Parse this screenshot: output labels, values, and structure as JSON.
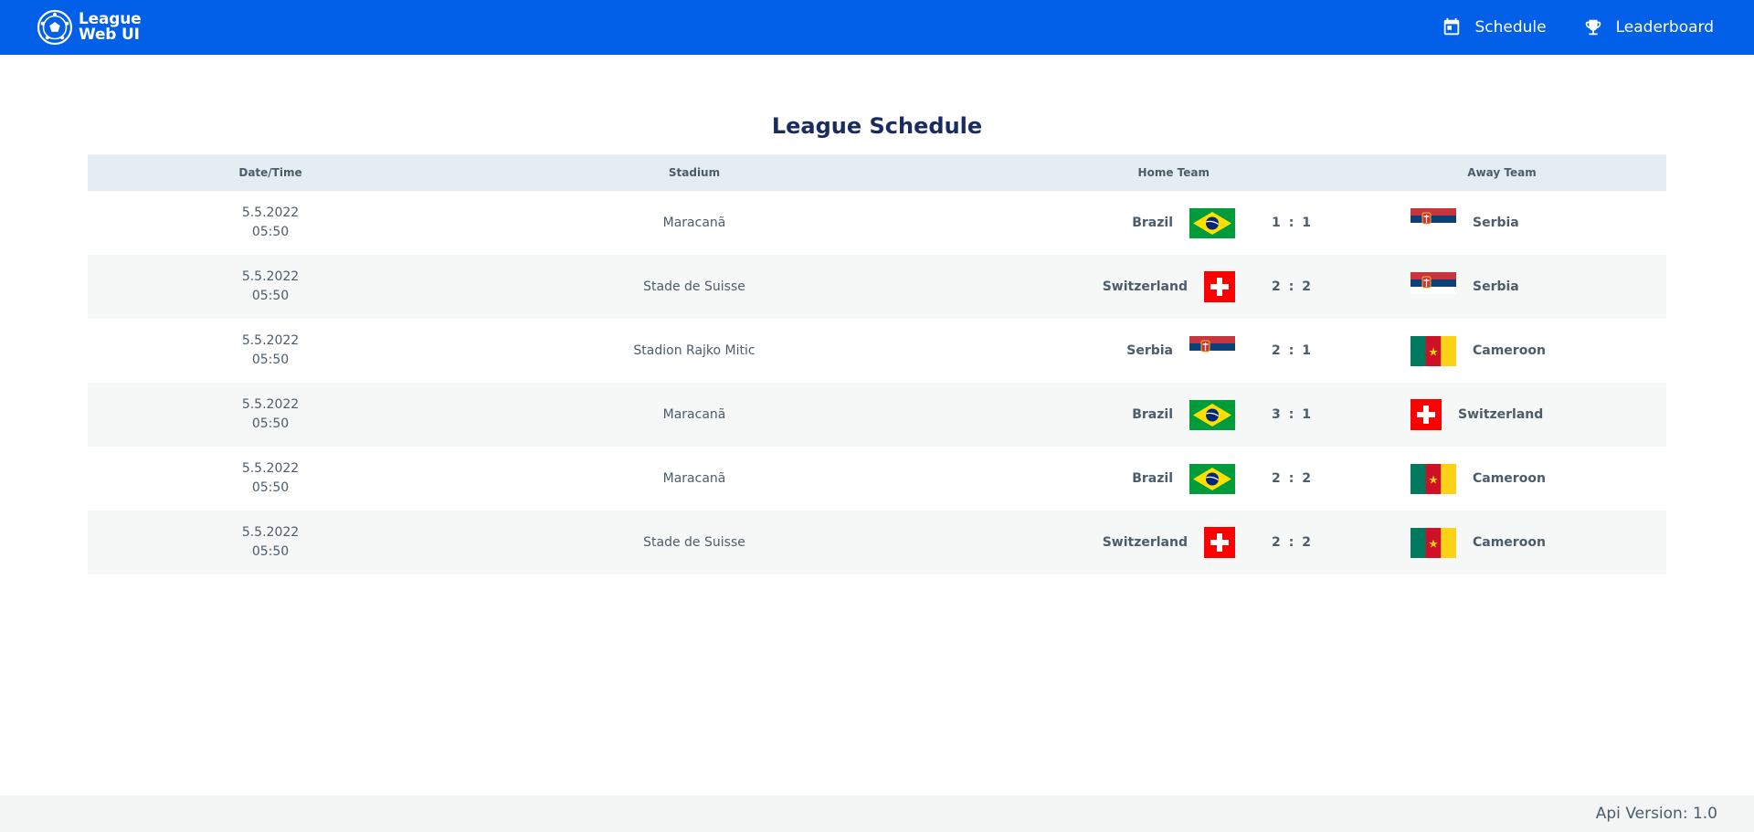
{
  "brand": {
    "line1": "League",
    "line2": "Web UI"
  },
  "nav": {
    "schedule_label": "Schedule",
    "leaderboard_label": "Leaderboard"
  },
  "page": {
    "title": "League Schedule"
  },
  "table": {
    "headers": {
      "datetime": "Date/Time",
      "stadium": "Stadium",
      "home": "Home Team",
      "away": "Away Team"
    },
    "rows": [
      {
        "date": "5.5.2022",
        "time": "05:50",
        "stadium": "Maracanã",
        "home": "Brazil",
        "home_flag": "brazil-flag-icon",
        "home_score": "1",
        "away_score": "1",
        "away": "Serbia",
        "away_flag": "serbia-flag-icon"
      },
      {
        "date": "5.5.2022",
        "time": "05:50",
        "stadium": "Stade de Suisse",
        "home": "Switzerland",
        "home_flag": "switzerland-flag-icon",
        "home_score": "2",
        "away_score": "2",
        "away": "Serbia",
        "away_flag": "serbia-flag-icon"
      },
      {
        "date": "5.5.2022",
        "time": "05:50",
        "stadium": "Stadion Rajko Mitic",
        "home": "Serbia",
        "home_flag": "serbia-flag-icon",
        "home_score": "2",
        "away_score": "1",
        "away": "Cameroon",
        "away_flag": "cameroon-flag-icon"
      },
      {
        "date": "5.5.2022",
        "time": "05:50",
        "stadium": "Maracanã",
        "home": "Brazil",
        "home_flag": "brazil-flag-icon",
        "home_score": "3",
        "away_score": "1",
        "away": "Switzerland",
        "away_flag": "switzerland-flag-icon"
      },
      {
        "date": "5.5.2022",
        "time": "05:50",
        "stadium": "Maracanã",
        "home": "Brazil",
        "home_flag": "brazil-flag-icon",
        "home_score": "2",
        "away_score": "2",
        "away": "Cameroon",
        "away_flag": "cameroon-flag-icon"
      },
      {
        "date": "5.5.2022",
        "time": "05:50",
        "stadium": "Stade de Suisse",
        "home": "Switzerland",
        "home_flag": "switzerland-flag-icon",
        "home_score": "2",
        "away_score": "2",
        "away": "Cameroon",
        "away_flag": "cameroon-flag-icon"
      }
    ]
  },
  "footer": {
    "api_version": "Api Version: 1.0"
  },
  "colors": {
    "navbar": "#025fe8",
    "title": "#182c62",
    "header_row": "#e4edf2",
    "text": "#4b5c6b"
  }
}
